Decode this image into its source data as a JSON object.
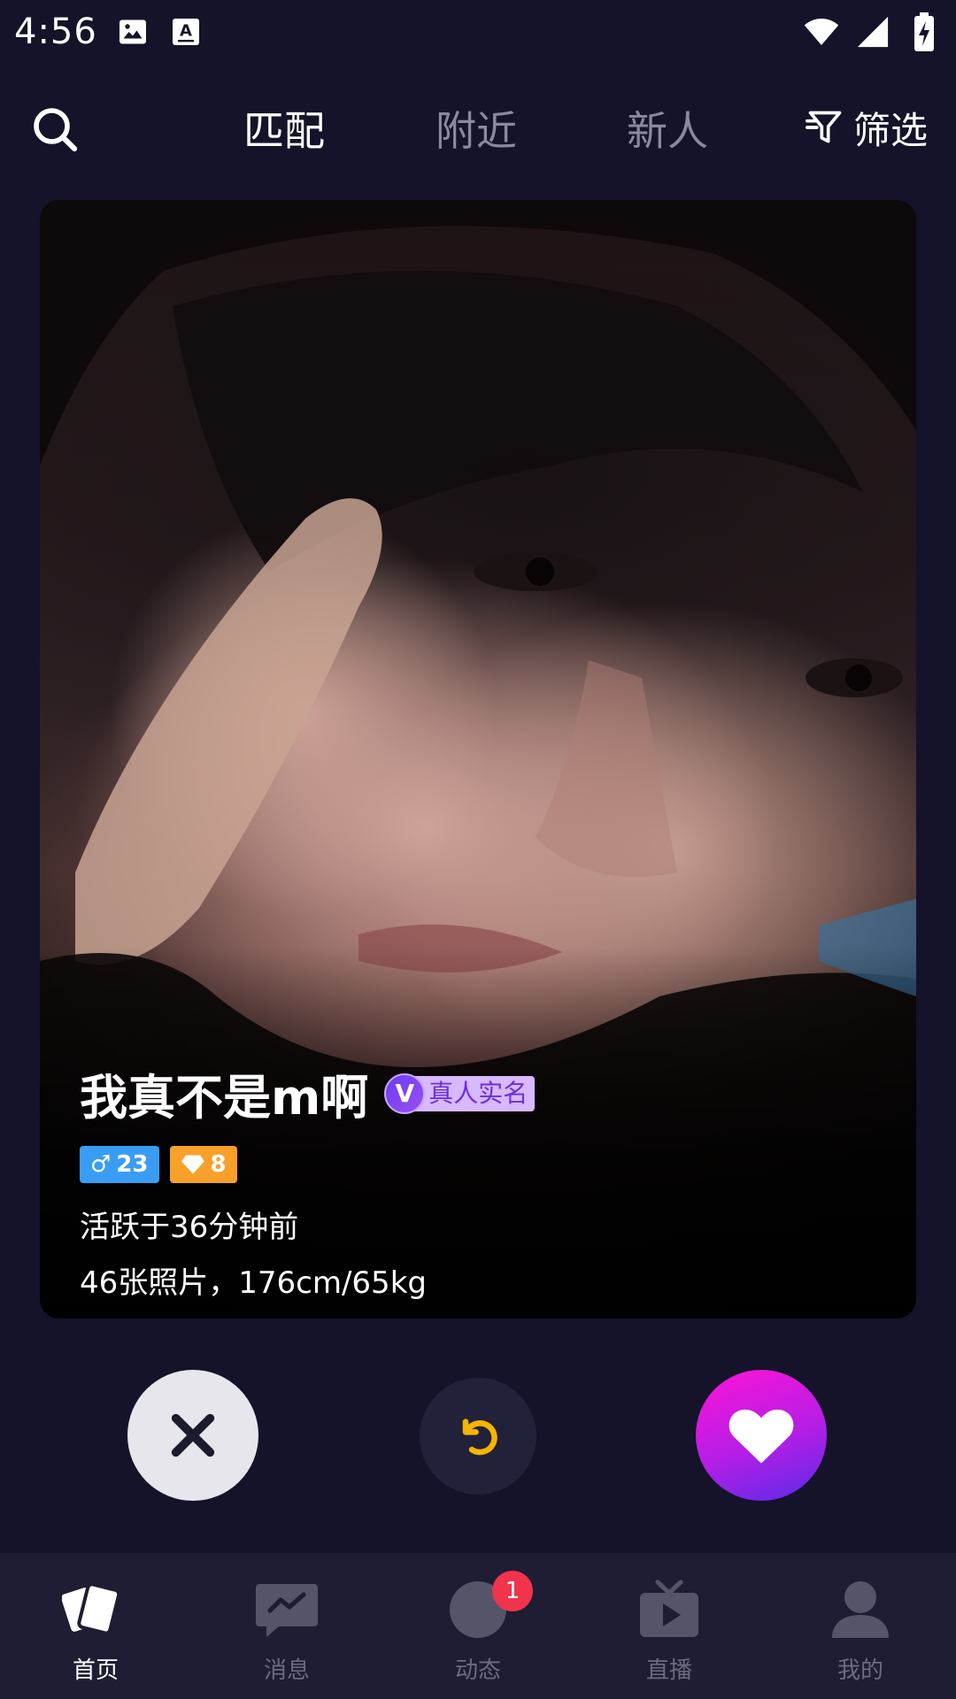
{
  "status_bar": {
    "time": "4:56",
    "left_icons": [
      "image-icon",
      "text-recognition-icon"
    ],
    "right_icons": [
      "wifi-icon",
      "signal-icon",
      "battery-charging-icon"
    ]
  },
  "top_nav": {
    "tabs": [
      {
        "label": "匹配",
        "active": true
      },
      {
        "label": "附近",
        "active": false
      },
      {
        "label": "新人",
        "active": false
      }
    ],
    "filter_label": "筛选"
  },
  "card": {
    "name": "我真不是m啊",
    "verified_mark": "V",
    "verified_label": "真人实名",
    "age": "23",
    "gender_symbol": "♂",
    "level": "8",
    "active_text": "活跃于36分钟前",
    "details": "46张照片，176cm/65kg"
  },
  "actions": {
    "dislike_icon": "close-icon",
    "undo_icon": "undo-icon",
    "like_icon": "heart-icon"
  },
  "bottom_nav": {
    "items": [
      {
        "label": "首页",
        "icon": "cards-icon",
        "active": true
      },
      {
        "label": "消息",
        "icon": "message-icon",
        "active": false
      },
      {
        "label": "动态",
        "icon": "moments-icon",
        "active": false,
        "badge": "1"
      },
      {
        "label": "直播",
        "icon": "tv-icon",
        "active": false
      },
      {
        "label": "我的",
        "icon": "profile-icon",
        "active": false
      }
    ]
  },
  "colors": {
    "background": "#14132a",
    "nav_bar": "#1e1d33",
    "accent_like": "#ff14d6",
    "undo_yellow": "#f5b400",
    "badge_red": "#f2334c"
  }
}
